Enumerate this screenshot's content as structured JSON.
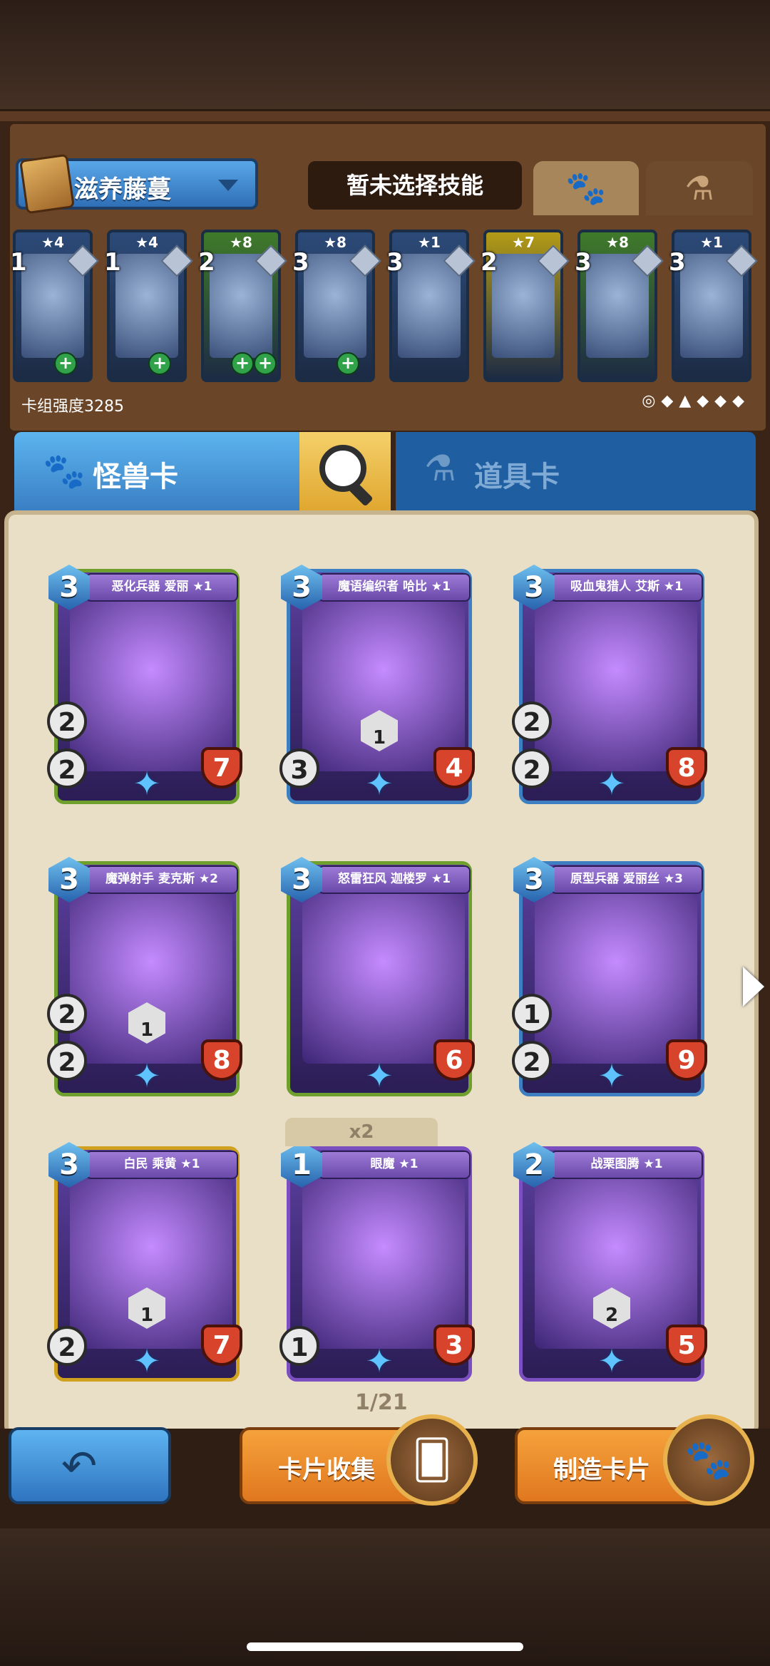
{
  "deck": {
    "name": "滋养藤蔓",
    "skill_label": "暂未选择技能",
    "power_label": "卡组强度3285",
    "mini_cards": [
      {
        "stars": "★4",
        "cost": "1",
        "plus": 1,
        "color": "#2c4a78"
      },
      {
        "stars": "★4",
        "cost": "1",
        "plus": 1,
        "color": "#2c4a78"
      },
      {
        "stars": "★8",
        "cost": "2",
        "plus": 2,
        "color": "#3f7a2a"
      },
      {
        "stars": "★8",
        "cost": "3",
        "plus": 1,
        "color": "#2c4a78"
      },
      {
        "stars": "★1",
        "cost": "3",
        "plus": 0,
        "color": "#2c4a78"
      },
      {
        "stars": "★7",
        "cost": "2",
        "plus": 0,
        "color": "#b39a16"
      },
      {
        "stars": "★8",
        "cost": "3",
        "plus": 0,
        "color": "#3f7a2a"
      },
      {
        "stars": "★1",
        "cost": "3",
        "plus": 0,
        "color": "#2c4a78"
      }
    ]
  },
  "tabs": {
    "monster": "怪兽卡",
    "props": "道具卡"
  },
  "cards": [
    {
      "name": "恶化兵器 爱丽 ★1",
      "cost": "3",
      "speed": "2",
      "attack": "2",
      "hp": "7",
      "ability": "",
      "color": "#6f9f2d"
    },
    {
      "name": "魔语编织者 哈比 ★1",
      "cost": "3",
      "speed": "",
      "attack": "3",
      "hp": "4",
      "ability": "1",
      "color": "#3d7fc0"
    },
    {
      "name": "吸血鬼猎人 艾斯 ★1",
      "cost": "3",
      "speed": "2",
      "attack": "2",
      "hp": "8",
      "ability": "",
      "color": "#3d7fc0"
    },
    {
      "name": "魔弹射手 麦克斯 ★2",
      "cost": "3",
      "speed": "2",
      "attack": "2",
      "hp": "8",
      "ability": "1",
      "color": "#6f9f2d"
    },
    {
      "name": "怒雷狂风 迦楼罗 ★1",
      "cost": "3",
      "speed": "",
      "attack": "",
      "hp": "6",
      "ability": "",
      "color": "#6f9f2d"
    },
    {
      "name": "原型兵器 爱丽丝 ★3",
      "cost": "3",
      "speed": "1",
      "attack": "2",
      "hp": "9",
      "ability": "",
      "color": "#3d7fc0"
    },
    {
      "name": "白民 乘黄 ★1",
      "cost": "3",
      "speed": "",
      "attack": "2",
      "hp": "7",
      "ability": "1",
      "color": "#d0a11f"
    },
    {
      "name": "眼魔 ★1",
      "cost": "1",
      "speed": "",
      "attack": "1",
      "hp": "3",
      "ability": "",
      "color": "#7b4fbf"
    },
    {
      "name": "战栗图腾 ★1",
      "cost": "2",
      "speed": "",
      "attack": "",
      "hp": "5",
      "ability": "2",
      "color": "#7b4fbf"
    }
  ],
  "duplicate_label": "x2",
  "pager": "1/21",
  "buttons": {
    "collect": "卡片收集",
    "craft": "制造卡片"
  }
}
